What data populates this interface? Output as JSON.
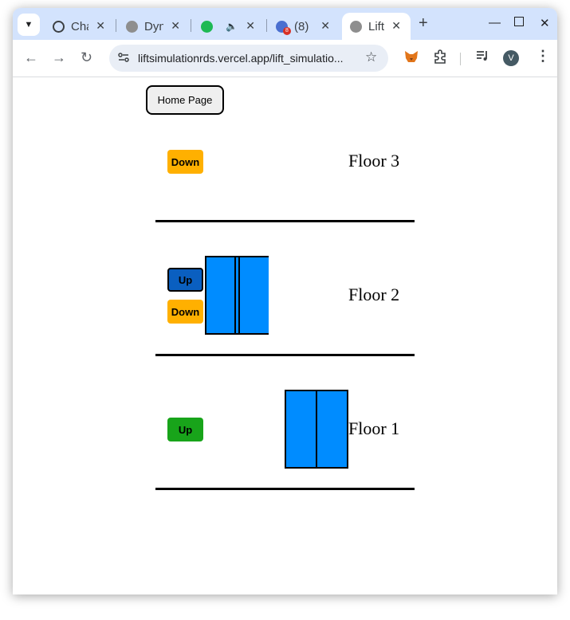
{
  "browser": {
    "tabs": [
      {
        "title": "Cha",
        "icon": "openai-icon",
        "color": "#5f6368"
      },
      {
        "title": "Dyn",
        "icon": "globe-icon",
        "color": "#8e8e8e"
      },
      {
        "title": "",
        "icon": "spotify-icon",
        "color": "#1db954"
      },
      {
        "title": "(8)",
        "icon": "app-icon",
        "color": "#d93025",
        "badge": "8"
      },
      {
        "title": "Lift",
        "icon": "globe-icon",
        "color": "#8e8e8e"
      }
    ],
    "url": "liftsimulationrds.vercel.app/lift_simulatio...",
    "profile_initial": "V"
  },
  "page": {
    "home_button": "Home Page",
    "floors": [
      {
        "label": "Floor 3",
        "buttons": [
          {
            "label": "Down",
            "color": "#ffb000"
          }
        ]
      },
      {
        "label": "Floor 2",
        "buttons": [
          {
            "label": "Up",
            "color": "#0a5fc0"
          },
          {
            "label": "Down",
            "color": "#ffb000"
          }
        ]
      },
      {
        "label": "Floor 1",
        "buttons": [
          {
            "label": "Up",
            "color": "#18a41a"
          }
        ]
      }
    ],
    "lifts": [
      {
        "floor": 2,
        "doors": "opening"
      },
      {
        "floor": 1,
        "doors": "closed"
      }
    ],
    "lift_color": "#008cff"
  }
}
